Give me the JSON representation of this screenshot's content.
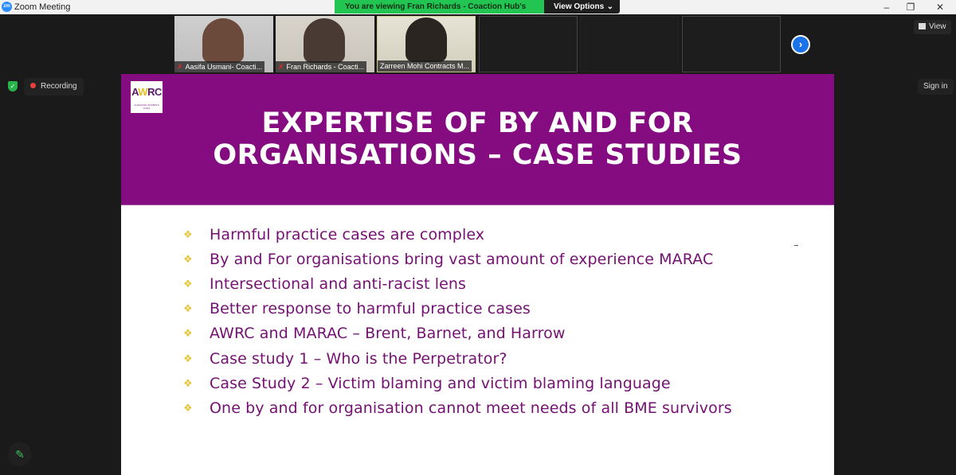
{
  "window": {
    "title": "Zoom Meeting",
    "logo_text": "zm",
    "controls": {
      "minimize": "–",
      "restore": "❐",
      "close": "✕"
    }
  },
  "share_banner": {
    "text": "You are viewing Fran Richards - Coaction Hub's screen",
    "view_options_label": "View Options",
    "chevron": "⌄"
  },
  "participants": [
    {
      "name": "Aasifa Usmani- Coacti...",
      "muted": true,
      "video": true
    },
    {
      "name": "Fran Richards - Coacti...",
      "muted": true,
      "video": true
    },
    {
      "name": "Zarreen Mohi Contracts M...",
      "muted": false,
      "video": true
    },
    {
      "name": "",
      "video": false
    },
    {
      "name": "",
      "video": false
    },
    {
      "name": "",
      "video": false
    }
  ],
  "controls": {
    "next_page_icon": "›",
    "view_label": "View",
    "recording_label": "Recording",
    "sign_in_label": "Sign in",
    "security_icon": "✓",
    "annotate_icon": "✎",
    "mic_off_icon": "✗"
  },
  "slide": {
    "logo_main_a": "A",
    "logo_main_w": "W",
    "logo_main_rc": "RC",
    "logo_sub": "CHANGING WOMEN'S LIVES",
    "title_line1": "EXPERTISE OF BY AND FOR",
    "title_line2": "ORGANISATIONS – CASE STUDIES",
    "bullet_icon": "❖",
    "bullets": [
      "Harmful practice cases are complex",
      "By and For organisations bring vast amount of experience MARAC",
      "Intersectional and anti-racist lens",
      "Better response to harmful practice cases",
      "AWRC and MARAC – Brent, Barnet, and Harrow",
      "Case study 1 – Who is the Perpetrator?",
      "Case Study 2 – Victim blaming and victim blaming language",
      "One  by and for organisation cannot meet needs of all BME survivors"
    ]
  },
  "colors": {
    "slide_purple": "#840b80",
    "bullet_text": "#741172",
    "bullet_diamond": "#e6c53a",
    "banner_green": "#23c552",
    "accent_blue": "#1a73e8",
    "recording_red": "#e8413c"
  }
}
